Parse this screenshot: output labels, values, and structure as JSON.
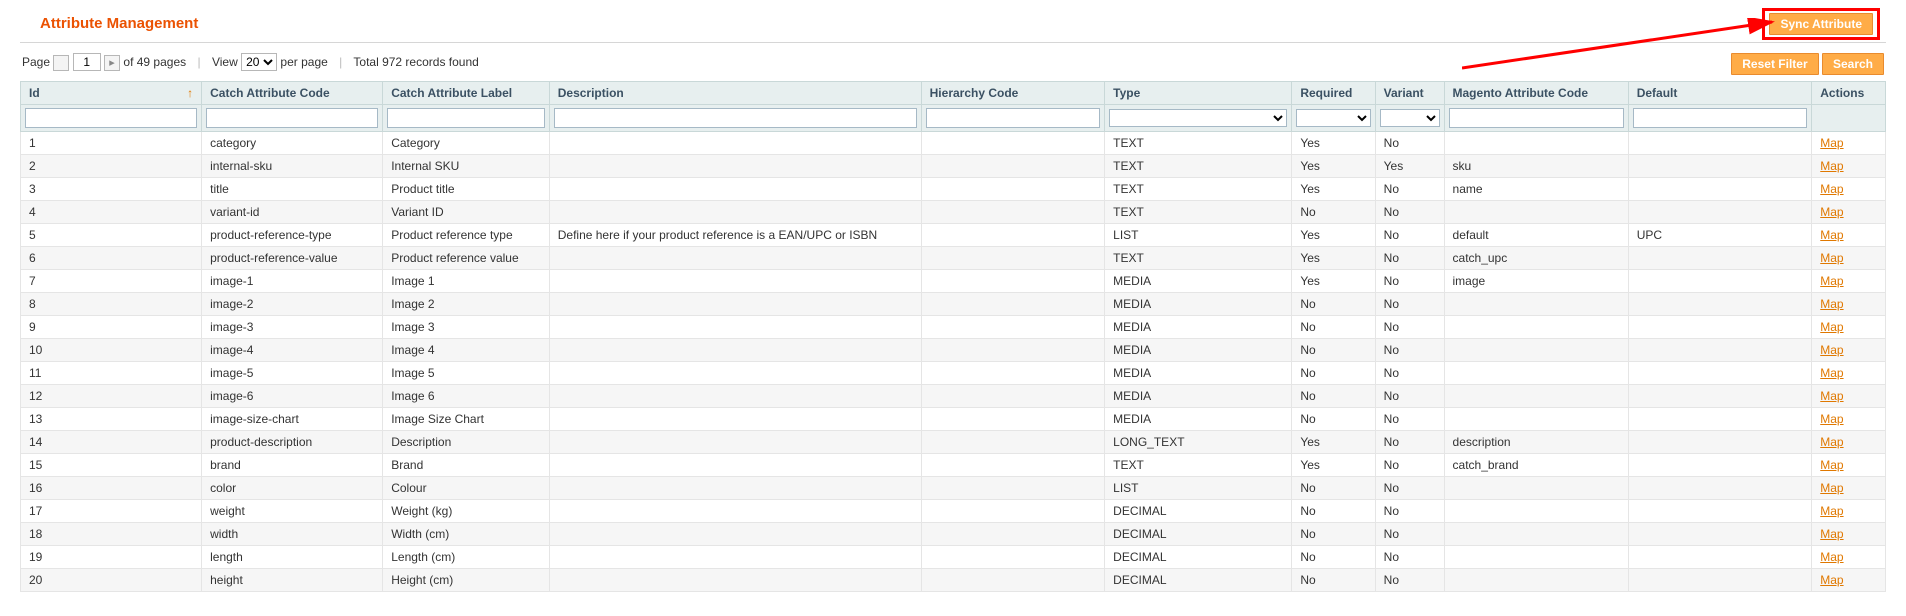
{
  "page_title": "Attribute Management",
  "buttons": {
    "sync": "Sync Attribute",
    "reset_filter": "Reset Filter",
    "search": "Search"
  },
  "toolbar": {
    "page_label": "Page",
    "page_value": "1",
    "of_pages": "of 49 pages",
    "view_label": "View",
    "per_page_value": "20",
    "per_page_label": "per page",
    "total_label": "Total 972 records found"
  },
  "columns": {
    "id": "Id",
    "catch_code": "Catch Attribute Code",
    "catch_label": "Catch Attribute Label",
    "description": "Description",
    "hierarchy": "Hierarchy Code",
    "type": "Type",
    "required": "Required",
    "variant": "Variant",
    "magento_code": "Magento Attribute Code",
    "default": "Default",
    "actions": "Actions"
  },
  "action_link_label": "Map",
  "rows": [
    {
      "id": "1",
      "code": "category",
      "label": "Category",
      "desc": "",
      "hier": "",
      "type": "TEXT",
      "req": "Yes",
      "var": "No",
      "mag": "",
      "def": ""
    },
    {
      "id": "2",
      "code": "internal-sku",
      "label": "Internal SKU",
      "desc": "",
      "hier": "",
      "type": "TEXT",
      "req": "Yes",
      "var": "Yes",
      "mag": "sku",
      "def": ""
    },
    {
      "id": "3",
      "code": "title",
      "label": "Product title",
      "desc": "",
      "hier": "",
      "type": "TEXT",
      "req": "Yes",
      "var": "No",
      "mag": "name",
      "def": ""
    },
    {
      "id": "4",
      "code": "variant-id",
      "label": "Variant ID",
      "desc": "",
      "hier": "",
      "type": "TEXT",
      "req": "No",
      "var": "No",
      "mag": "",
      "def": ""
    },
    {
      "id": "5",
      "code": "product-reference-type",
      "label": "Product reference type",
      "desc": "Define here if your product reference is a EAN/UPC or ISBN",
      "hier": "",
      "type": "LIST",
      "req": "Yes",
      "var": "No",
      "mag": "default",
      "def": "UPC"
    },
    {
      "id": "6",
      "code": "product-reference-value",
      "label": "Product reference value",
      "desc": "",
      "hier": "",
      "type": "TEXT",
      "req": "Yes",
      "var": "No",
      "mag": "catch_upc",
      "def": ""
    },
    {
      "id": "7",
      "code": "image-1",
      "label": "Image 1",
      "desc": "",
      "hier": "",
      "type": "MEDIA",
      "req": "Yes",
      "var": "No",
      "mag": "image",
      "def": ""
    },
    {
      "id": "8",
      "code": "image-2",
      "label": "Image 2",
      "desc": "",
      "hier": "",
      "type": "MEDIA",
      "req": "No",
      "var": "No",
      "mag": "",
      "def": ""
    },
    {
      "id": "9",
      "code": "image-3",
      "label": "Image 3",
      "desc": "",
      "hier": "",
      "type": "MEDIA",
      "req": "No",
      "var": "No",
      "mag": "",
      "def": ""
    },
    {
      "id": "10",
      "code": "image-4",
      "label": "Image 4",
      "desc": "",
      "hier": "",
      "type": "MEDIA",
      "req": "No",
      "var": "No",
      "mag": "",
      "def": ""
    },
    {
      "id": "11",
      "code": "image-5",
      "label": "Image 5",
      "desc": "",
      "hier": "",
      "type": "MEDIA",
      "req": "No",
      "var": "No",
      "mag": "",
      "def": ""
    },
    {
      "id": "12",
      "code": "image-6",
      "label": "Image 6",
      "desc": "",
      "hier": "",
      "type": "MEDIA",
      "req": "No",
      "var": "No",
      "mag": "",
      "def": ""
    },
    {
      "id": "13",
      "code": "image-size-chart",
      "label": "Image Size Chart",
      "desc": "",
      "hier": "",
      "type": "MEDIA",
      "req": "No",
      "var": "No",
      "mag": "",
      "def": ""
    },
    {
      "id": "14",
      "code": "product-description",
      "label": "Description",
      "desc": "",
      "hier": "",
      "type": "LONG_TEXT",
      "req": "Yes",
      "var": "No",
      "mag": "description",
      "def": ""
    },
    {
      "id": "15",
      "code": "brand",
      "label": "Brand",
      "desc": "",
      "hier": "",
      "type": "TEXT",
      "req": "Yes",
      "var": "No",
      "mag": "catch_brand",
      "def": ""
    },
    {
      "id": "16",
      "code": "color",
      "label": "Colour",
      "desc": "",
      "hier": "",
      "type": "LIST",
      "req": "No",
      "var": "No",
      "mag": "",
      "def": ""
    },
    {
      "id": "17",
      "code": "weight",
      "label": "Weight (kg)",
      "desc": "",
      "hier": "",
      "type": "DECIMAL",
      "req": "No",
      "var": "No",
      "mag": "",
      "def": ""
    },
    {
      "id": "18",
      "code": "width",
      "label": "Width (cm)",
      "desc": "",
      "hier": "",
      "type": "DECIMAL",
      "req": "No",
      "var": "No",
      "mag": "",
      "def": ""
    },
    {
      "id": "19",
      "code": "length",
      "label": "Length (cm)",
      "desc": "",
      "hier": "",
      "type": "DECIMAL",
      "req": "No",
      "var": "No",
      "mag": "",
      "def": ""
    },
    {
      "id": "20",
      "code": "height",
      "label": "Height (cm)",
      "desc": "",
      "hier": "",
      "type": "DECIMAL",
      "req": "No",
      "var": "No",
      "mag": "",
      "def": ""
    }
  ]
}
